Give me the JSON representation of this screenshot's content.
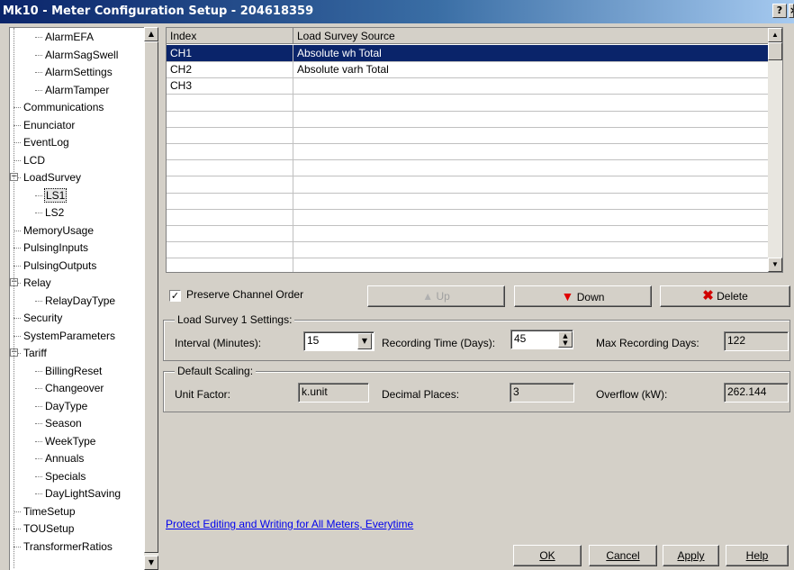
{
  "window": {
    "title": "Mk10 - Meter Configuration Setup - 204618359",
    "help_btn": "?",
    "close_btn": "×"
  },
  "tree": [
    {
      "label": "AlarmEFA",
      "level": 2
    },
    {
      "label": "AlarmSagSwell",
      "level": 2
    },
    {
      "label": "AlarmSettings",
      "level": 2
    },
    {
      "label": "AlarmTamper",
      "level": 2
    },
    {
      "label": "Communications",
      "level": 1
    },
    {
      "label": "Enunciator",
      "level": 1
    },
    {
      "label": "EventLog",
      "level": 1
    },
    {
      "label": "LCD",
      "level": 1
    },
    {
      "label": "LoadSurvey",
      "level": 1,
      "expander": "−"
    },
    {
      "label": "LS1",
      "level": 2,
      "selected": true
    },
    {
      "label": "LS2",
      "level": 2
    },
    {
      "label": "MemoryUsage",
      "level": 1
    },
    {
      "label": "PulsingInputs",
      "level": 1
    },
    {
      "label": "PulsingOutputs",
      "level": 1
    },
    {
      "label": "Relay",
      "level": 1,
      "expander": "−"
    },
    {
      "label": "RelayDayType",
      "level": 2
    },
    {
      "label": "Security",
      "level": 1
    },
    {
      "label": "SystemParameters",
      "level": 1
    },
    {
      "label": "Tariff",
      "level": 1,
      "expander": "−"
    },
    {
      "label": "BillingReset",
      "level": 2
    },
    {
      "label": "Changeover",
      "level": 2
    },
    {
      "label": "DayType",
      "level": 2
    },
    {
      "label": "Season",
      "level": 2
    },
    {
      "label": "WeekType",
      "level": 2
    },
    {
      "label": "Annuals",
      "level": 2
    },
    {
      "label": "Specials",
      "level": 2
    },
    {
      "label": "DayLightSaving",
      "level": 2
    },
    {
      "label": "TimeSetup",
      "level": 1
    },
    {
      "label": "TOUSetup",
      "level": 1
    },
    {
      "label": "TransformerRatios",
      "level": 1
    }
  ],
  "grid": {
    "columns": [
      "Index",
      "Load Survey Source"
    ],
    "rows": [
      {
        "index": "CH1",
        "source": "Absolute wh Total"
      },
      {
        "index": "CH2",
        "source": "Absolute varh Total"
      },
      {
        "index": "CH3",
        "source": ""
      }
    ]
  },
  "controls": {
    "preserve_label": "Preserve Channel Order",
    "preserve_checked": "✓",
    "up_label": "Up",
    "down_label": "Down",
    "delete_label": "Delete"
  },
  "ls_settings": {
    "title": "Load Survey 1 Settings:",
    "interval_label": "Interval (Minutes):",
    "interval_value": "15",
    "recording_label": "Recording Time (Days):",
    "recording_value": "45",
    "max_label": "Max Recording Days:",
    "max_value": "122"
  },
  "scaling": {
    "title": "Default Scaling:",
    "unit_factor_label": "Unit Factor:",
    "unit_factor_value": "k.unit",
    "decimal_label": "Decimal Places:",
    "decimal_value": "3",
    "overflow_label": "Overflow (kW):",
    "overflow_value": "262.144"
  },
  "footer": {
    "link": "Protect Editing and Writing for All Meters, Everytime",
    "ok": "OK",
    "cancel": "Cancel",
    "apply": "Apply",
    "help": "Help"
  },
  "colors": {
    "titlebar": "#0a246a",
    "selection": "#0a246a",
    "down_arrow": "#e00000",
    "delete_x": "#d00000"
  }
}
